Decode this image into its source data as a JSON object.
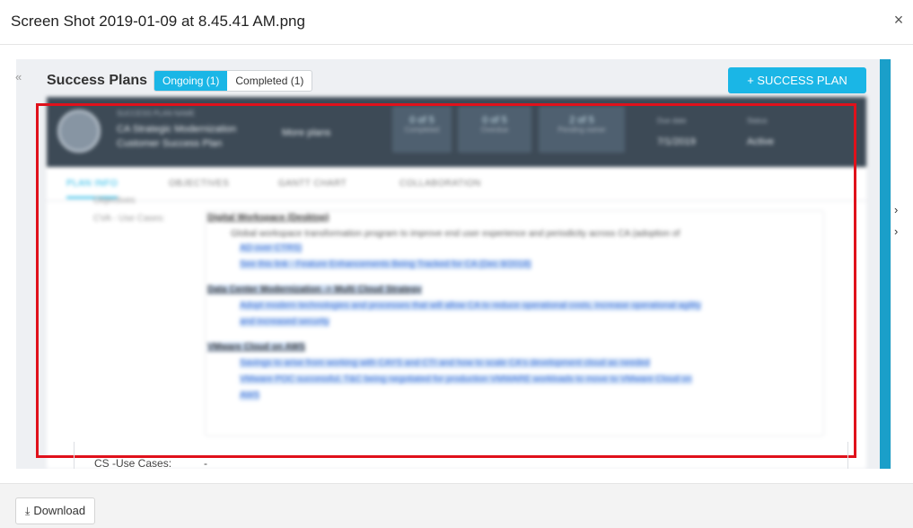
{
  "modal": {
    "title": "Screen Shot 2019-01-09 at 8.45.41 AM.png",
    "close_icon": "×",
    "download_label": "Download",
    "download_icon": "⤓"
  },
  "screenshot": {
    "collapse_icon": "«",
    "right_arrows": [
      "›",
      "›"
    ],
    "header": {
      "title": "Success Plans",
      "segments": [
        {
          "label": "Ongoing (1)",
          "active": true
        },
        {
          "label": "Completed (1)",
          "active": false
        }
      ],
      "add_button": "+ SUCCESS PLAN"
    },
    "plan_bar": {
      "name_caption": "SUCCESS PLAN NAME",
      "name_line1": "CA Strategic Modernization",
      "name_line2": "Customer Success Plan",
      "more_plans": "More plans",
      "stats": [
        {
          "value": "0 of 5",
          "label": "Completed"
        },
        {
          "value": "0 of 5",
          "label": "Overdue"
        },
        {
          "value": "2 of 5",
          "label": "Pending owner"
        }
      ],
      "due_date_label": "Due date",
      "due_date_value": "7/1/2019",
      "status_label": "Status",
      "status_value": "Active"
    },
    "tabs": [
      "PLAN INFO",
      "OBJECTIVES",
      "GANTT CHART",
      "COLLABORATION"
    ],
    "content": {
      "label_objectives": "Objectives",
      "label_cva": "CVA - Use Cases:",
      "sections": [
        {
          "heading": "Digital Workspace (Desktop)",
          "items": [
            "Global workspace transformation program to improve end user experience and periodicity across CA (adoption of",
            "AD over CTRS)",
            "See this link - Feature Enhancements Being Tracked for CA (Dec 8/2018)"
          ]
        },
        {
          "heading": "Data Center Modernization -> Multi Cloud Strategy",
          "items": [
            "Adopt modern technologies and processes that will allow CA to reduce operational costs, increase operational agility",
            "and increased security"
          ]
        },
        {
          "heading": "VMware Cloud on AWS",
          "items": [
            "Savings to arise from working with CAYS and CTI and how to scale CA's development cloud as needed",
            "VMware POC successful, T&C being negotiated for production VMWARE workloads to move to VMware Cloud on",
            "AWS"
          ]
        }
      ]
    },
    "use_cases_label": "CS -Use Cases:",
    "use_cases_value": "-",
    "annotation_color": "#e0111b",
    "accent_color": "#1ab6e6"
  }
}
